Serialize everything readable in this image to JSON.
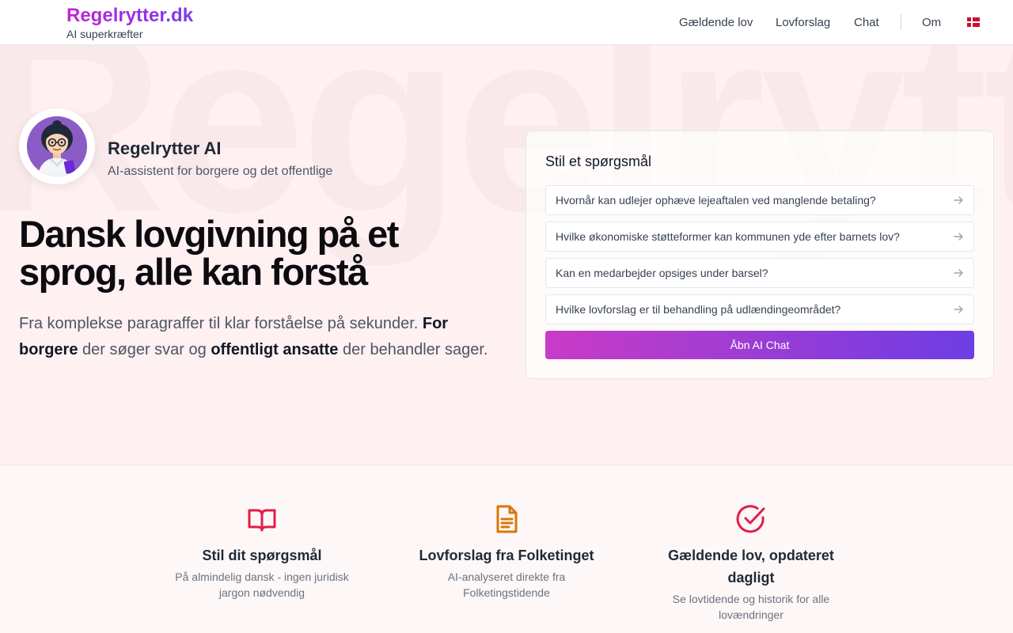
{
  "header": {
    "brand_name": "Regelrytter.dk",
    "brand_tagline": "AI superkræfter",
    "nav": [
      {
        "label": "Gældende lov"
      },
      {
        "label": "Lovforslag"
      },
      {
        "label": "Chat"
      },
      {
        "label": "Om"
      }
    ],
    "language_icon": "danish-flag-icon"
  },
  "hero": {
    "watermark": "Regelrytter",
    "assistant_name": "Regelrytter AI",
    "assistant_subtitle": "AI-assistent for borgere og det offentlige",
    "heading": "Dansk lovgivning på et sprog, alle kan forstå",
    "description": {
      "part1": "Fra komplekse paragraffer til klar forståelse på sekunder. ",
      "bold1": "For borgere",
      "part2": " der søger svar og ",
      "bold2": "offentligt ansatte",
      "part3": " der behandler sager."
    }
  },
  "ask_card": {
    "title": "Stil et spørgsmål",
    "questions": [
      {
        "text": "Hvornår kan udlejer ophæve lejeaftalen ved manglende betaling?"
      },
      {
        "text": "Hvilke økonomiske støtteformer kan kommunen yde efter barnets lov?"
      },
      {
        "text": "Kan en medarbejder opsiges under barsel?"
      },
      {
        "text": "Hvilke lovforslag er til behandling på udlændingeområdet?"
      }
    ],
    "button_label": "Åbn AI Chat"
  },
  "features": [
    {
      "icon": "book-open-icon",
      "color": "#e11d48",
      "title": "Stil dit spørgsmål",
      "desc": "På almindelig dansk - ingen juridisk jargon nødvendig"
    },
    {
      "icon": "document-icon",
      "color": "#d97706",
      "title": "Lovforslag fra Folketinget",
      "desc": "AI-analyseret direkte fra Folketingstidende"
    },
    {
      "icon": "check-circle-icon",
      "color": "#e11d48",
      "title": "Gældende lov, opdateret dagligt",
      "desc": "Se lovtidende og historik for alle lovændringer"
    }
  ],
  "colors": {
    "brand_gradient_start": "#c026d3",
    "brand_gradient_end": "#7c3aed",
    "hero_background": "#fff0f1"
  }
}
